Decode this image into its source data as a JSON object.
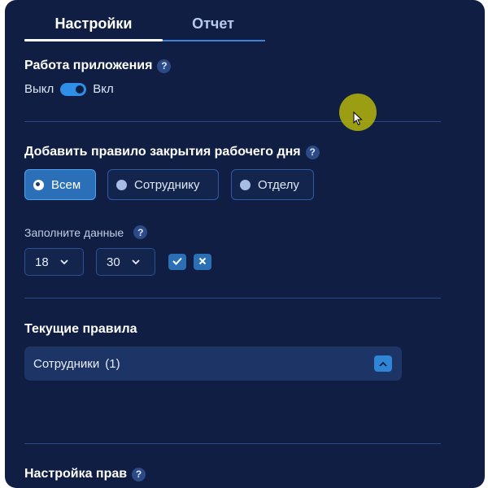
{
  "tabs": {
    "settings": "Настройки",
    "report": "Отчет"
  },
  "app_work": {
    "title": "Работа приложения",
    "help": "?",
    "off_label": "Выкл",
    "on_label": "Вкл"
  },
  "add_rule": {
    "title": "Добавить правило закрытия рабочего дня",
    "help": "?",
    "options": [
      "Всем",
      "Сотруднику",
      "Отделу"
    ],
    "selected": "Всем"
  },
  "fill_data": {
    "label": "Заполните данные",
    "help": "?",
    "hour_value": "18",
    "minute_value": "30"
  },
  "current_rules": {
    "title": "Текущие правила",
    "group_label": "Сотрудники",
    "group_count": "(1)"
  },
  "rights": {
    "title": "Настройка прав",
    "help": "?"
  },
  "colors": {
    "panel_bg": "#0f1e42",
    "accent": "#2f8ee6",
    "active_option": "#2a6fb8"
  },
  "icons": [
    "help-icon",
    "toggle-switch",
    "radio-dot-icon",
    "chevron-down-icon",
    "check-icon",
    "close-icon",
    "chevron-up-icon",
    "mouse-cursor-icon"
  ]
}
